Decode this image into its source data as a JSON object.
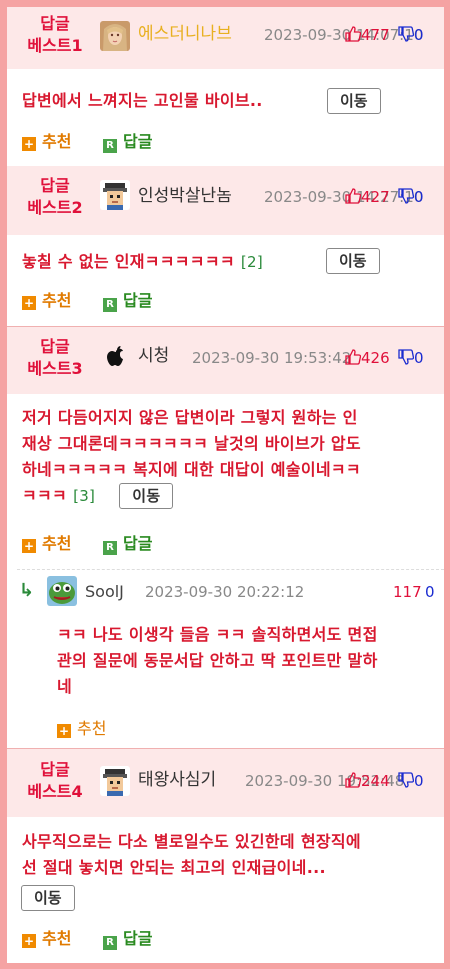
{
  "posts": [
    {
      "badge": [
        "답글",
        "베스트1"
      ],
      "nick": "에스더니나브",
      "date": "2023-09-30 14:07:10",
      "up": "477",
      "down": "0",
      "body": [
        "답변에서 느껴지는 고인물 바이브.."
      ],
      "count": "",
      "move": "이동",
      "recommend": "추천",
      "reply": "답글"
    },
    {
      "badge": [
        "답글",
        "베스트2"
      ],
      "nick": "인성박살난놈",
      "date": "2023-09-30 14:27:10",
      "up": "427",
      "down": "0",
      "body": [
        "놓칠 수 없는 인재ㅋㅋㅋㅋㅋㅋ"
      ],
      "count": "[2]",
      "move": "이동",
      "recommend": "추천",
      "reply": "답글"
    },
    {
      "badge": [
        "답글",
        "베스트3"
      ],
      "nick": "시청",
      "date": "2023-09-30 19:53:42",
      "up": "426",
      "down": "0",
      "body": [
        "저거 다듬어지지 않은 답변이라 그렇지 원하는 인",
        "재상 그대론데ㅋㅋㅋㅋㅋㅋ 날것의 바이브가 압도",
        "하네ㅋㅋㅋㅋㅋ 복지에 대한 대답이 예술이네ㅋㅋ",
        "ㅋㅋㅋ"
      ],
      "count": "[3]",
      "move": "이동",
      "recommend": "추천",
      "reply": "답글"
    },
    {
      "badge": [
        "답글",
        "베스트4"
      ],
      "nick": "태왕사심기",
      "date": "2023-09-30 19:52:48",
      "up": "244",
      "down": "0",
      "body": [
        "사무직으로는 다소 별로일수도 있긴한데 현장직에",
        "선 절대 놓치면 안되는 최고의 인재급이네..."
      ],
      "count": "",
      "move": "이동",
      "recommend": "추천",
      "reply": "답글"
    }
  ],
  "subreply": {
    "arrow": "↳",
    "nick": "SoolJ",
    "date": "2023-09-30 20:22:12",
    "up": "117",
    "down": "0",
    "body": [
      "ㅋㅋ 나도 이생각 들음 ㅋㅋ 솔직하면서도 면접",
      "관의 질문에 동문서답 안하고 딱 포인트만 말하",
      "네"
    ],
    "recommend": "추천"
  },
  "icons": {
    "up": "thumbs-up-icon",
    "down": "thumbs-down-icon",
    "recommend": "plus-square-icon",
    "reply": "reply-r-icon"
  },
  "colors": {
    "accent_red": "#e0103a",
    "header_bg": "#fde8e8",
    "frame": "#f5a3a3",
    "down_blue": "#1a2bd0",
    "recommend_orange": "#e07a00",
    "reply_green": "#2a8a20"
  }
}
